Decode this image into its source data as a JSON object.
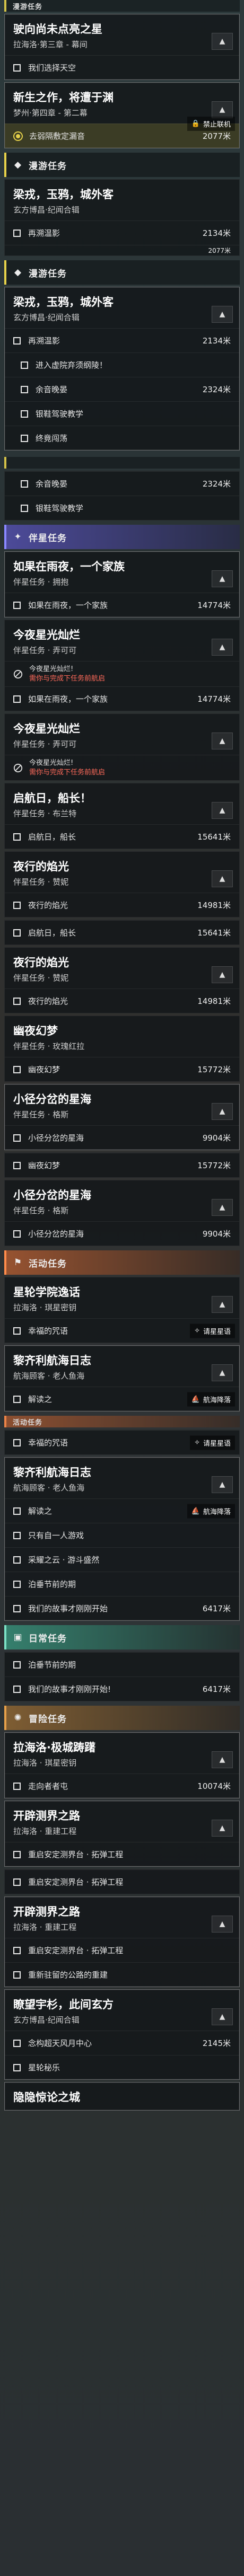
{
  "sections": {
    "trailblaze": "漫游任务",
    "companion": "伴星任务",
    "event": "活动任务",
    "daily": "日常任务",
    "adventure": "冒险任务"
  },
  "quests": {
    "q1": {
      "title": "驶向尚未点亮之星",
      "sub": "拉海洛·第三章 - 幕间"
    },
    "q2": {
      "title": "新生之作，将遭于渊",
      "sub": "梦州·第四章 - 第二幕"
    },
    "q3": {
      "title": "梁戎，玉鸦，城外客",
      "sub": "玄方博昌·纪闻合辑"
    },
    "q4": {
      "title": "梁戎，玉鸦，城外客",
      "sub": "玄方博昌·纪闻合辑"
    },
    "q5": {
      "title": "如果在雨夜，一个家族",
      "sub": "伴星任务 · 拥抱"
    },
    "q6": {
      "title": "今夜星光灿烂",
      "sub": "伴星任务 · 弄可可"
    },
    "q7": {
      "title": "今夜星光灿烂",
      "sub": "伴星任务 · 弄可可"
    },
    "q8": {
      "title": "启航日，船长！",
      "sub": "伴星任务 · 布兰特"
    },
    "q9": {
      "title": "夜行的焰光",
      "sub": "伴星任务 · 赞妮"
    },
    "q10": {
      "title": "夜行的焰光",
      "sub": "伴星任务 · 赞妮"
    },
    "q11": {
      "title": "幽夜幻梦",
      "sub": "伴星任务 · 玫瑰红拉"
    },
    "q12": {
      "title": "小径分岔的星海",
      "sub": "伴星任务 · 格斯"
    },
    "q13": {
      "title": "小径分岔的星海",
      "sub": "伴星任务 · 格斯"
    },
    "q14": {
      "title": "星轮学院逸话",
      "sub": "拉海洛 · 琪星密钥"
    },
    "q15": {
      "title": "黎齐利航海日志",
      "sub": "航海顾客 · 老人鱼海"
    },
    "q16": {
      "title": "黎齐利航海日志",
      "sub": "航海顾客 · 老人鱼海"
    },
    "q17": {
      "title": "拉海洛·极城踌躇",
      "sub": "拉海洛 · 琪星密钥"
    },
    "q18": {
      "title": "开辟测界之路",
      "sub": "拉海洛 · 重建工程"
    },
    "q19": {
      "title": "开辟测界之路",
      "sub": "拉海洛 · 重建工程"
    },
    "q20": {
      "title": "瞭望宇杉，此间玄方",
      "sub": "玄方博昌·纪闻合辑"
    },
    "q21": {
      "title": "隐隐惊论之城",
      "sub": ""
    }
  },
  "objectives": {
    "o1": "我们选择天空",
    "o2": "去弱隔敷定漏音",
    "o3": "再溯温影",
    "o4": "再溯温影",
    "o5": "进入虚院弃须纲陵！",
    "o6": "余音晚晏",
    "o7": "银鞋驾驶教学",
    "o8": "终竟闯荡",
    "o9": "余音晚晏",
    "o10": "银鞋驾驶教学",
    "o11": "如果在雨夜，一个家族",
    "o12": "如果在雨夜，一个家族",
    "o13": "启航日，船长",
    "o14": "夜行的焰光",
    "o15": "启航日，船长",
    "o16": "夜行的焰光",
    "o17": "幽夜幻梦",
    "o18": "小径分岔的星海",
    "o19": "幽夜幻梦",
    "o20": "小径分岔的星海",
    "o21": "幸福的咒语",
    "o22": "解读之",
    "o23": "只有自一人游戏",
    "o24": "采耀之云 · 游斗盛然",
    "o25": "泊垂节前的期",
    "o26": "我们的故事才刚刚开始",
    "o27": "泊垂节前的期",
    "o28": "我们的故事才刚刚开始!",
    "o29": "走向者者屯",
    "o30": "重启安定测界台 · 拓弹工程",
    "o31": "重启安定测界台 · 拓弹工程",
    "o32": "重启安定测界台 · 拓弹工程",
    "o33": "重新驻留的公路的重建",
    "o34": "念构超天风月中心",
    "o35": "星轮秘乐"
  },
  "distances": {
    "d1": "2077米",
    "d2": "2134米",
    "d3": "2077米",
    "d4": "2134米",
    "d5": "2324米",
    "d6": "2324米",
    "d7": "14774米",
    "d8": "14774米",
    "d9": "15641米",
    "d10": "14981米",
    "d11": "15641米",
    "d12": "14981米",
    "d13": "15772米",
    "d14": "9904米",
    "d15": "15772米",
    "d16": "9904米",
    "d17": "6417米",
    "d18": "6417米",
    "d19": "10074米",
    "d20": "2145米"
  },
  "fail_notes": {
    "line1": "今夜星光灿烂!",
    "line2": "需你与完成下任务前航启"
  },
  "badges": {
    "b1": "禁止联机",
    "b2": "请星星语",
    "b3": "航海降落",
    "b4": "请星星语",
    "b5": "航海降落"
  },
  "colors": {
    "trailblaze": "#e6d14a",
    "companion": "#8a88ff",
    "event": "#ff8c4b",
    "daily": "#7ce0c5",
    "adventure": "#e6a04a"
  }
}
